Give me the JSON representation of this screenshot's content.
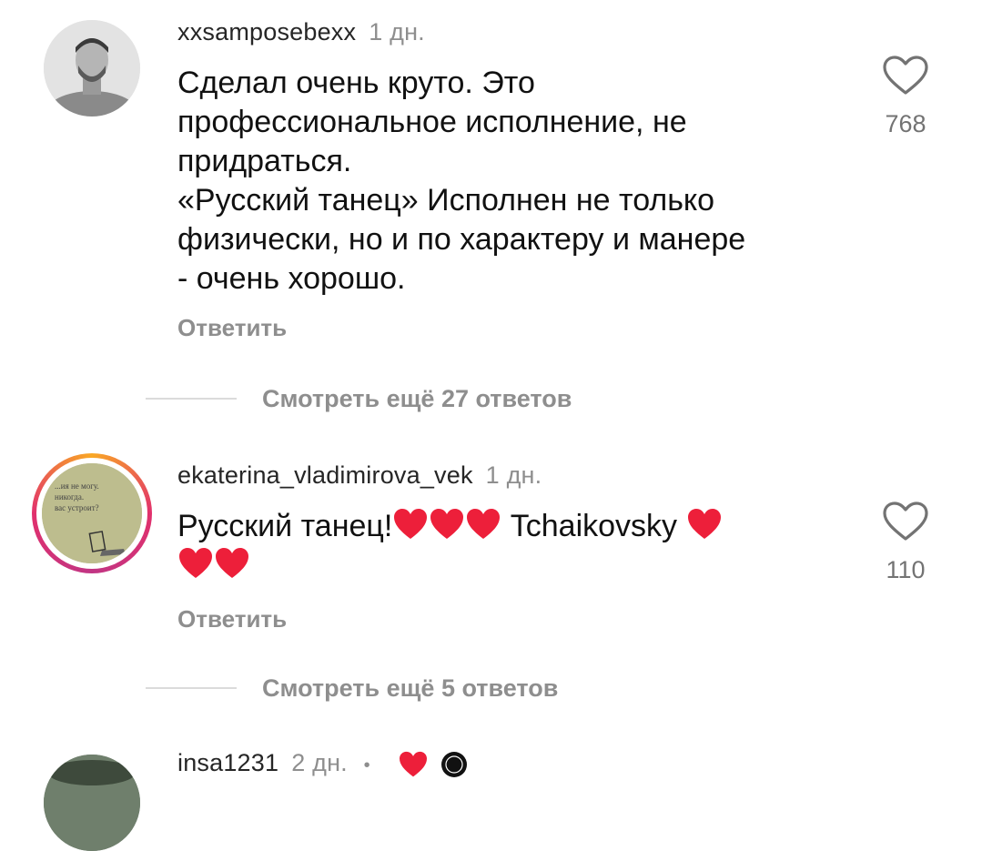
{
  "comments": [
    {
      "username": "xxsamposebexx",
      "time": "1 дн.",
      "text": "Сделал очень круто. Это\nпрофессиональное исполнение, не\nпридраться.\n«Русский танец» Исполнен не только\nфизически, но и по характеру и манере\n- очень хорошо.",
      "likes": "768",
      "reply_label": "Ответить",
      "view_more": "Смотреть ещё 27 ответов"
    },
    {
      "username": "ekaterina_vladimirova_vek",
      "time": "1 дн.",
      "text_prefix": "Русский танец!",
      "text_middle": " Tchaikovsky ",
      "avatar_text": "...ия не могу.\nникогда.\nвас устроит?",
      "likes": "110",
      "reply_label": "Ответить",
      "view_more": "Смотреть ещё 5 ответов"
    },
    {
      "username": "insa1231",
      "time": "2 дн.",
      "separator": "•"
    }
  ],
  "colors": {
    "heart_red": "#ed1f3a",
    "muted": "#8e8e8e",
    "story_ring": "#e1306c"
  },
  "icons": {
    "like": "heart-outline-icon",
    "emoji_heart": "red-heart-emoji"
  }
}
